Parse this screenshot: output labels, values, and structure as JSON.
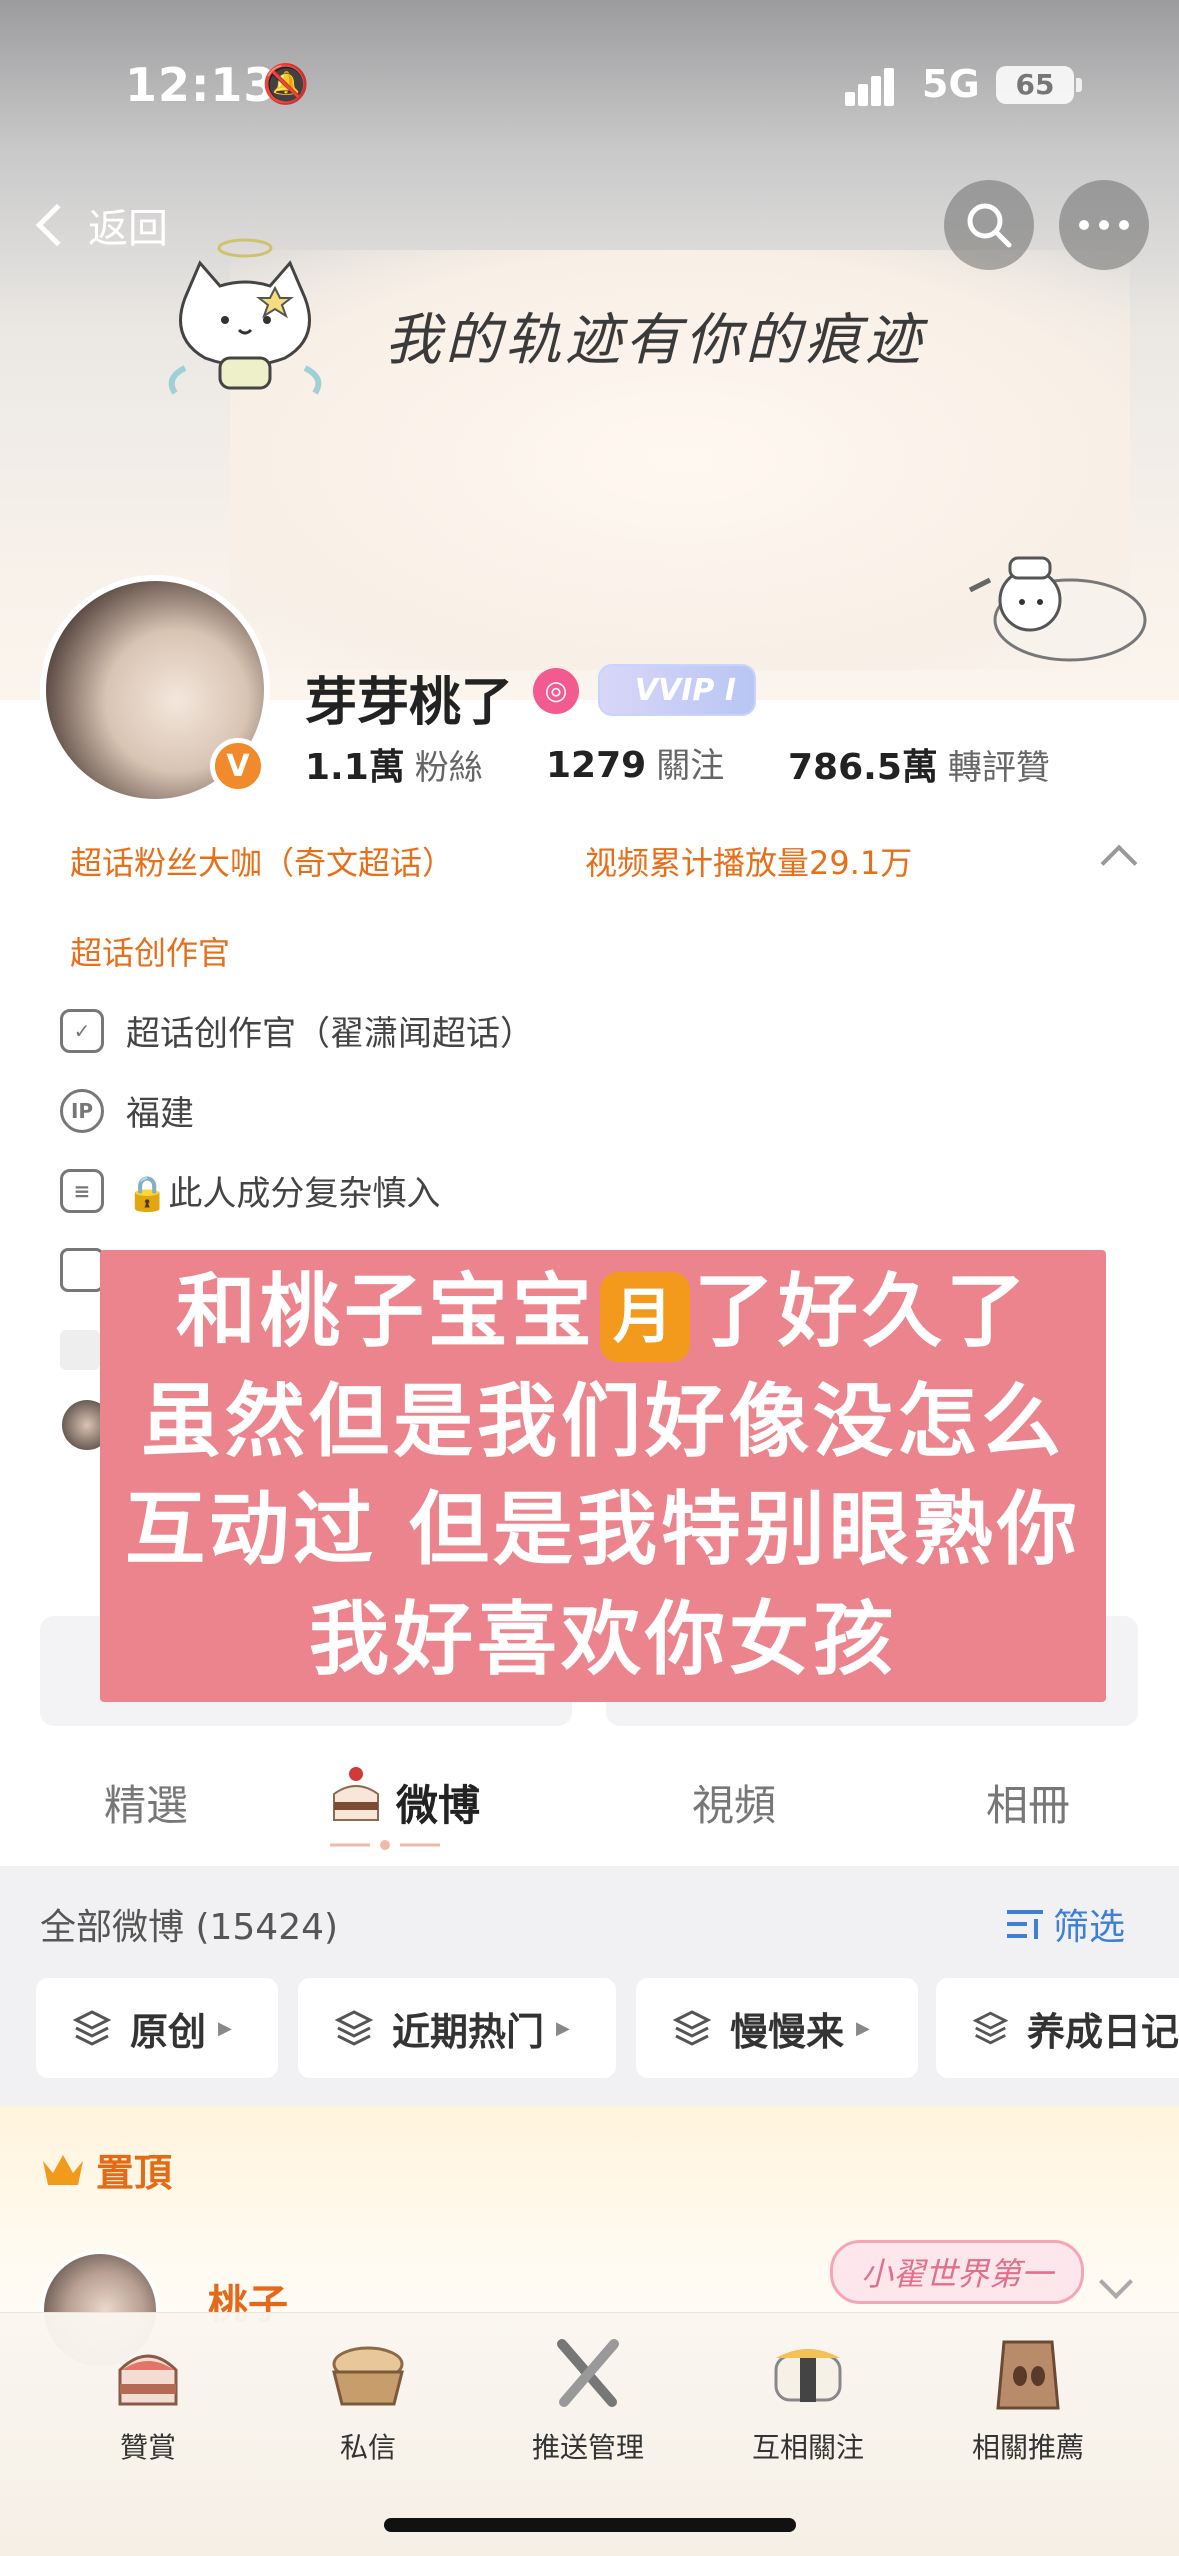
{
  "status_bar": {
    "time": "12:13",
    "network": "5G",
    "battery": "65"
  },
  "nav": {
    "back_label": "返回"
  },
  "banner": {
    "motto": "我的轨迹有你的痕迹"
  },
  "profile": {
    "username": "芽芽桃了",
    "vip_label": "VVIP I",
    "verified_mark": "V",
    "stats": [
      {
        "value": "1.1萬",
        "label": "粉絲"
      },
      {
        "value": "1279",
        "label": "關注"
      },
      {
        "value": "786.5萬",
        "label": "轉評贊"
      }
    ],
    "badges": [
      "超话粉丝大咖（奇文超话）",
      "视频累计播放量29.1万",
      "超话创作官"
    ],
    "info_rows": [
      {
        "icon": "shield-icon",
        "text": "超话创作官（翟潇闻超话）"
      },
      {
        "icon": "ip-icon",
        "icon_text": "IP",
        "text": "福建"
      },
      {
        "icon": "document-icon",
        "text": "🔒此人成分复杂慎入"
      }
    ]
  },
  "overlay": {
    "line1_a": "和桃子宝宝",
    "moon": "月",
    "line1_b": "了好久了",
    "line2": "虽然但是我们好像没怎么",
    "line3": "互动过 但是我特别眼熟你",
    "line4": "我好喜欢你女孩",
    "bg_color": "#ec848d"
  },
  "tabs": [
    {
      "label": "精選",
      "active": false
    },
    {
      "label": "微博",
      "active": true
    },
    {
      "label": "視頻",
      "active": false
    },
    {
      "label": "相冊",
      "active": false
    }
  ],
  "feed": {
    "count_label": "全部微博 (15424)",
    "filter_label": "筛选",
    "chips": [
      "原创",
      "近期热门",
      "慢慢来",
      "养成日记"
    ]
  },
  "pinned": {
    "label": "置頂",
    "author": "桃子",
    "tagline": "小翟世界第一"
  },
  "toolbar": {
    "items": [
      {
        "label": "贊賞",
        "icon": "cake-icon"
      },
      {
        "label": "私信",
        "icon": "bread-basket-icon"
      },
      {
        "label": "推送管理",
        "icon": "utensils-icon"
      },
      {
        "label": "互相關注",
        "icon": "sushi-icon"
      },
      {
        "label": "相關推薦",
        "icon": "coffee-bag-icon"
      }
    ]
  },
  "colors": {
    "accent_orange": "#e76f1a",
    "link_blue": "#3f7fd6",
    "overlay_pink": "#ec848d"
  }
}
